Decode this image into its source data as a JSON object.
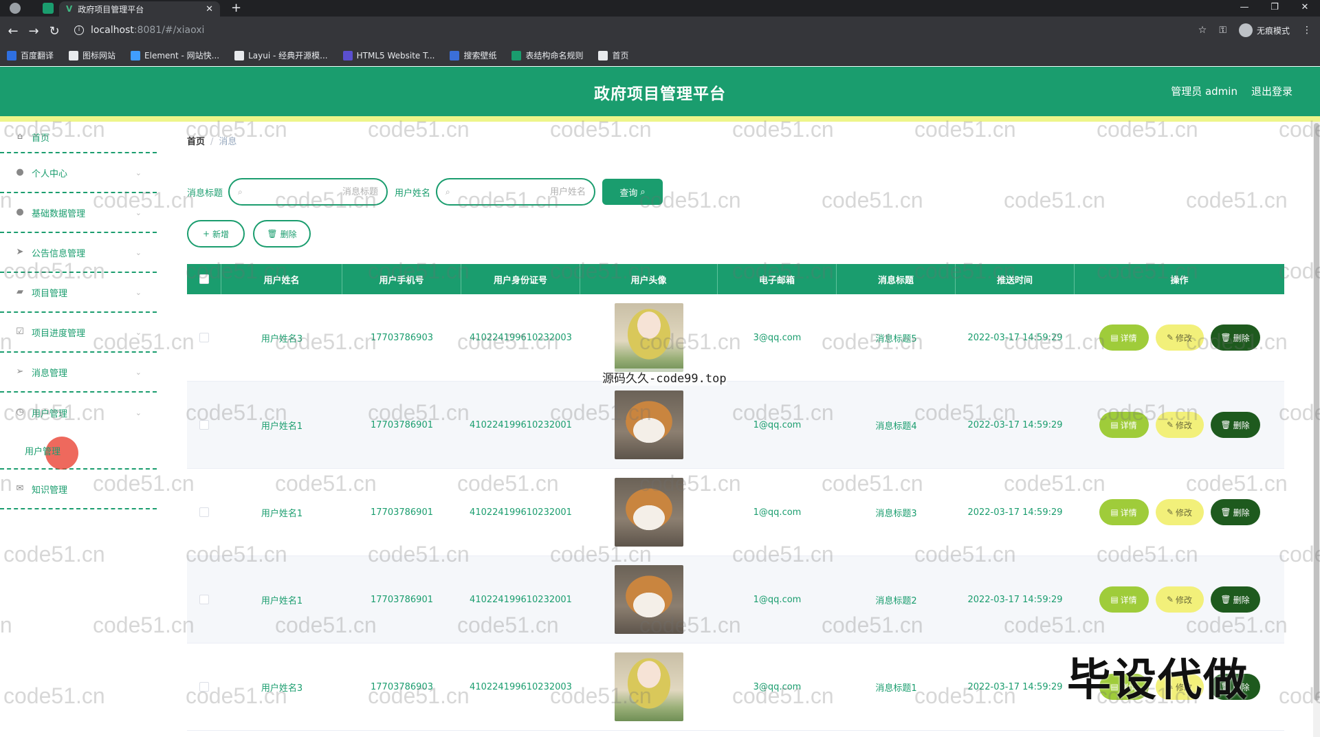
{
  "browser": {
    "tab_title": "政府项目管理平台",
    "tab_logo": "V",
    "url_host": "localhost",
    "url_rest": ":8081/#/xiaoxi",
    "incognito_label": "无痕模式",
    "bookmarks": [
      {
        "label": "百度翻译",
        "icon": "baidu-translate-icon",
        "color": "#2f6fe0"
      },
      {
        "label": "图标网站",
        "icon": "flag-icon",
        "color": "#e8eaed"
      },
      {
        "label": "Element - 网站快...",
        "icon": "element-icon",
        "color": "#409eff"
      },
      {
        "label": "Layui - 经典开源模...",
        "icon": "layui-icon",
        "color": "#e8eaed"
      },
      {
        "label": "HTML5 Website T...",
        "icon": "html5-icon",
        "color": "#5a4fcf"
      },
      {
        "label": "搜索壁纸",
        "icon": "wallpaper-icon",
        "color": "#3b6fd8"
      },
      {
        "label": "表结构命名规则",
        "icon": "sheet-icon",
        "color": "#1a9d6e"
      },
      {
        "label": "首页",
        "icon": "globe-icon",
        "color": "#e8eaed"
      }
    ]
  },
  "header": {
    "title": "政府项目管理平台",
    "user_label": "管理员 admin",
    "logout_label": "退出登录"
  },
  "sidebar": {
    "items": [
      {
        "label": "首页",
        "icon": "home-icon",
        "glyph": "⌂",
        "has_chevron": false
      },
      {
        "label": "个人中心",
        "icon": "user-icon",
        "glyph": "●",
        "has_chevron": true
      },
      {
        "label": "基础数据管理",
        "icon": "user-icon",
        "glyph": "●",
        "has_chevron": true
      },
      {
        "label": "公告信息管理",
        "icon": "send-icon",
        "glyph": "➤",
        "has_chevron": true
      },
      {
        "label": "项目管理",
        "icon": "chat-icon",
        "glyph": "▰",
        "has_chevron": true
      },
      {
        "label": "项目进度管理",
        "icon": "checkbox-icon",
        "glyph": "☑",
        "has_chevron": true
      },
      {
        "label": "消息管理",
        "icon": "send-icon",
        "glyph": "➢",
        "has_chevron": true
      },
      {
        "label": "用户管理",
        "icon": "clock-icon",
        "glyph": "◷",
        "has_chevron": true
      }
    ],
    "submenu_label": "用户管理",
    "last_item": {
      "label": "知识管理",
      "icon": "mail-icon",
      "glyph": "✉"
    }
  },
  "breadcrumb": {
    "home": "首页",
    "separator": "/",
    "current": "消息"
  },
  "search": {
    "title_label": "消息标题",
    "title_placeholder": "消息标题",
    "name_label": "用户姓名",
    "name_placeholder": "用户姓名",
    "query_label": "查询"
  },
  "actions": {
    "add_label": "新增",
    "delete_label": "删除"
  },
  "table": {
    "columns": [
      "用户姓名",
      "用户手机号",
      "用户身份证号",
      "用户头像",
      "电子邮箱",
      "消息标题",
      "推送时间",
      "操作"
    ],
    "rows": [
      {
        "name": "用户姓名3",
        "phone": "17703786903",
        "id_card": "410224199610232003",
        "avatar": "girl",
        "email": "3@qq.com",
        "title": "消息标题5",
        "time": "2022-03-17 14:59:29"
      },
      {
        "name": "用户姓名1",
        "phone": "17703786901",
        "id_card": "410224199610232001",
        "avatar": "dog",
        "email": "1@qq.com",
        "title": "消息标题4",
        "time": "2022-03-17 14:59:29"
      },
      {
        "name": "用户姓名1",
        "phone": "17703786901",
        "id_card": "410224199610232001",
        "avatar": "dog",
        "email": "1@qq.com",
        "title": "消息标题3",
        "time": "2022-03-17 14:59:29"
      },
      {
        "name": "用户姓名1",
        "phone": "17703786901",
        "id_card": "410224199610232001",
        "avatar": "dog",
        "email": "1@qq.com",
        "title": "消息标题2",
        "time": "2022-03-17 14:59:29"
      },
      {
        "name": "用户姓名3",
        "phone": "17703786903",
        "id_card": "410224199610232003",
        "avatar": "girl",
        "email": "3@qq.com",
        "title": "消息标题1",
        "time": "2022-03-17 14:59:29"
      }
    ],
    "op_detail": "详情",
    "op_edit": "修改",
    "op_delete": "删除"
  },
  "overlays": {
    "source_text": "源码久久-code99.top",
    "big_text": "毕设代做",
    "watermark": "code51.cn"
  },
  "colors": {
    "primary": "#1a9d6e",
    "accent_yellow": "#eef58a",
    "detail_btn": "#9fcc3a",
    "edit_btn": "#f2f07a",
    "delete_btn": "#1e5a1e"
  }
}
